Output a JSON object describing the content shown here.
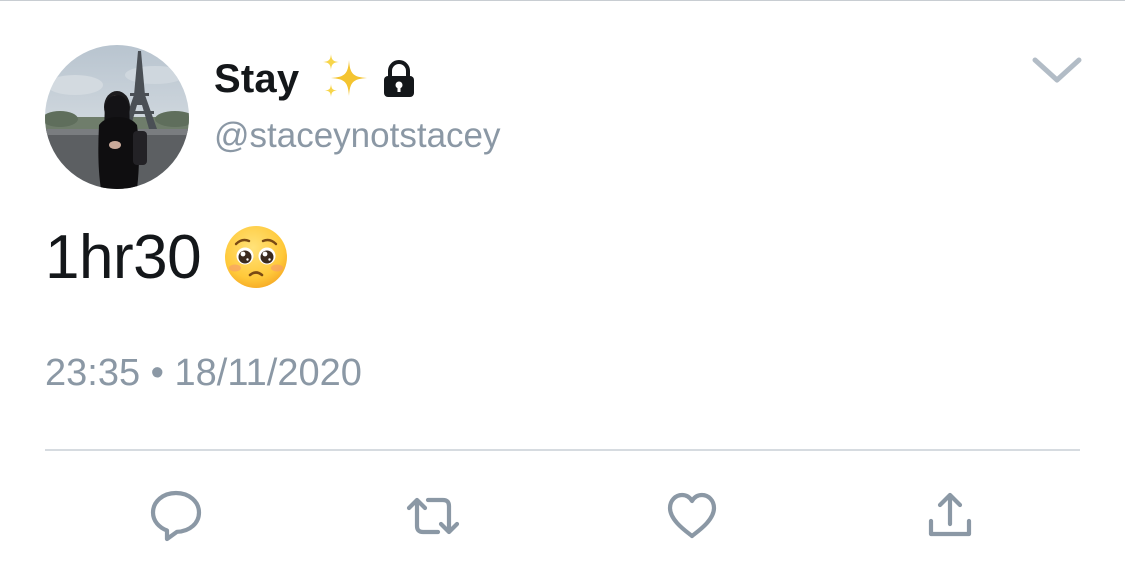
{
  "author": {
    "display_name": "Stay",
    "handle": "@staceynotstacey",
    "badges": [
      "sparkles-icon",
      "lock-icon"
    ]
  },
  "tweet": {
    "text": "1hr30",
    "emoji": "pleading-face-icon",
    "timestamp": "23:35 • 18/11/2020"
  },
  "actions": [
    "reply-icon",
    "retweet-icon",
    "like-icon",
    "share-icon"
  ],
  "colors": {
    "text_primary": "#14171a",
    "text_secondary": "#8b98a5",
    "icon": "#8b98a5",
    "sparkle_gold": "#f4c430",
    "divider": "#d6dbe0"
  }
}
